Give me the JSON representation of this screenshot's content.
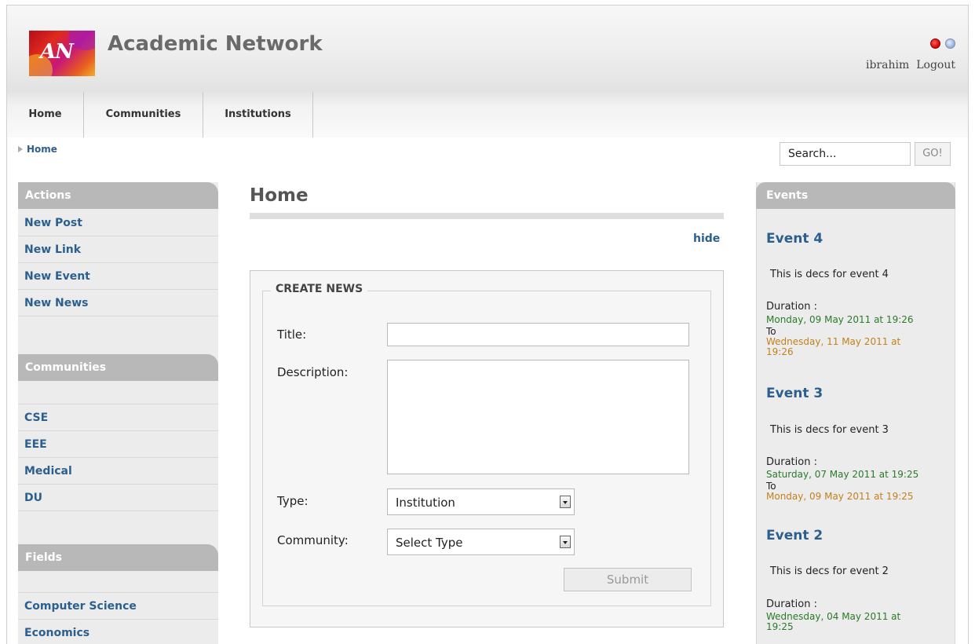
{
  "header": {
    "logo_text": "AN",
    "site_title": "Academic Network",
    "username": "ibrahim",
    "logout_label": "Logout"
  },
  "nav": {
    "items": [
      {
        "label": "Home"
      },
      {
        "label": "Communities"
      },
      {
        "label": "Institutions"
      }
    ]
  },
  "breadcrumb": {
    "current": "Home"
  },
  "search": {
    "placeholder": "Search...",
    "go_label": "GO!"
  },
  "sidebar": {
    "actions_heading": "Actions",
    "actions": [
      {
        "label": "New Post"
      },
      {
        "label": "New Link"
      },
      {
        "label": "New Event"
      },
      {
        "label": "New News"
      }
    ],
    "communities_heading": "Communities",
    "communities": [
      {
        "label": "CSE"
      },
      {
        "label": "EEE"
      },
      {
        "label": "Medical"
      },
      {
        "label": "DU"
      }
    ],
    "fields_heading": "Fields",
    "fields": [
      {
        "label": "Computer Science"
      },
      {
        "label": "Economics"
      }
    ]
  },
  "main": {
    "title": "Home",
    "hide_label": "hide",
    "form": {
      "legend": "CREATE NEWS",
      "title_label": "Title:",
      "title_value": "",
      "description_label": "Description:",
      "description_value": "",
      "type_label": "Type:",
      "type_selected": "Institution",
      "community_label": "Community:",
      "community_selected": "Select Type",
      "submit_label": "Submit"
    }
  },
  "events": {
    "heading": "Events",
    "duration_label": "Duration :",
    "to_label": "To",
    "items": [
      {
        "title": "Event 4",
        "description": "This is decs for event 4",
        "start_line1": "Monday, 09 May 2011 at 19:26",
        "end_line1": "Wednesday, 11 May 2011 at",
        "end_line2": "19:26"
      },
      {
        "title": "Event 3",
        "description": "This is decs for event 3",
        "start_line1": "Saturday, 07 May 2011 at 19:25",
        "end_line1": "Monday, 09 May 2011 at 19:25"
      },
      {
        "title": "Event 2",
        "description": "This is decs for event 2",
        "start_line1": "Wednesday, 04 May 2011 at",
        "start_line2": "19:25"
      }
    ]
  },
  "colors": {
    "link": "#2d5f8e",
    "panel_header": "#b8b8b8",
    "event_start": "#2a7a2a",
    "event_end": "#c3811c"
  }
}
